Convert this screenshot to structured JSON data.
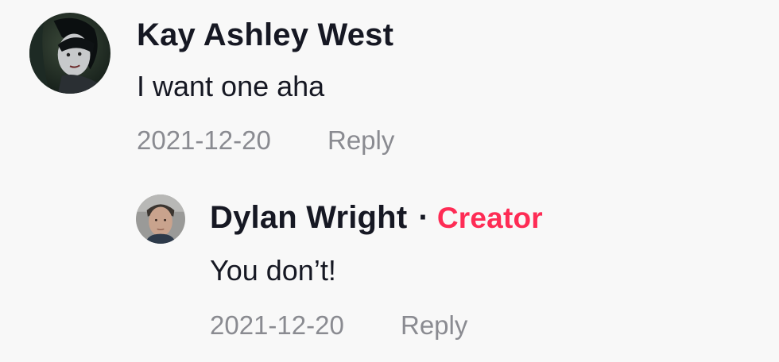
{
  "comments": [
    {
      "author": "Kay Ashley West",
      "text": "I want one aha",
      "date": "2021-12-20",
      "reply_label": "Reply",
      "avatar_icon": "user-photo-avatar"
    }
  ],
  "replies": [
    {
      "author": "Dylan Wright",
      "separator": "·",
      "badge": "Creator",
      "text": "You don’t!",
      "date": "2021-12-20",
      "reply_label": "Reply",
      "avatar_icon": "user-photo-avatar"
    }
  ],
  "colors": {
    "background": "#f8f8f8",
    "text": "#161823",
    "muted": "#8a8b91",
    "creator_badge": "#fe2c55"
  }
}
